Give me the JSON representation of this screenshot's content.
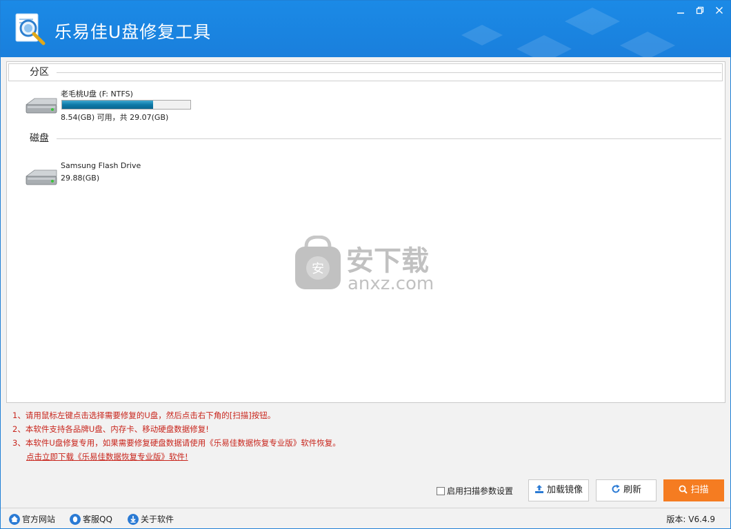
{
  "window": {
    "title": "乐易佳U盘修复工具",
    "minimize_icon": "minimize-icon",
    "restore_icon": "restore-icon",
    "close_icon": "close-icon"
  },
  "partitions": {
    "label": "分区",
    "items": [
      {
        "name": "老毛桃U盘 (F: NTFS)",
        "usage_text": "8.54(GB) 可用，共 29.07(GB)",
        "used_fraction": 0.71
      }
    ]
  },
  "disks": {
    "label": "磁盘",
    "items": [
      {
        "name": "Samsung Flash Drive",
        "size_text": "29.88(GB)"
      }
    ]
  },
  "watermark": {
    "brand": "安下载",
    "domain": "anxz.com",
    "badge": "安"
  },
  "notes": {
    "line1": "1、请用鼠标左键点击选择需要修复的U盘，然后点击右下角的[扫描]按钮。",
    "line2": "2、本软件支持各品牌U盘、内存卡、移动硬盘数据修复!",
    "line3": "3、本软件U盘修复专用，如果需要修复硬盘数据请使用《乐易佳数据恢复专业版》软件恢复。",
    "link": "点击立即下载《乐易佳数据恢复专业版》软件!"
  },
  "actions": {
    "scan_params_label": "启用扫描参数设置",
    "scan_params_checked": false,
    "load_image_label": "加载镜像",
    "refresh_label": "刷新",
    "scan_label": "扫描"
  },
  "statusbar": {
    "website_label": "官方网站",
    "qq_label": "客服QQ",
    "about_label": "关于软件",
    "version_text": "版本: V6.4.9"
  },
  "colors": {
    "titlebar": "#1b8ae6",
    "accent_orange": "#f57c21",
    "note_red": "#c8241b",
    "progress": "#0e7aa8"
  }
}
